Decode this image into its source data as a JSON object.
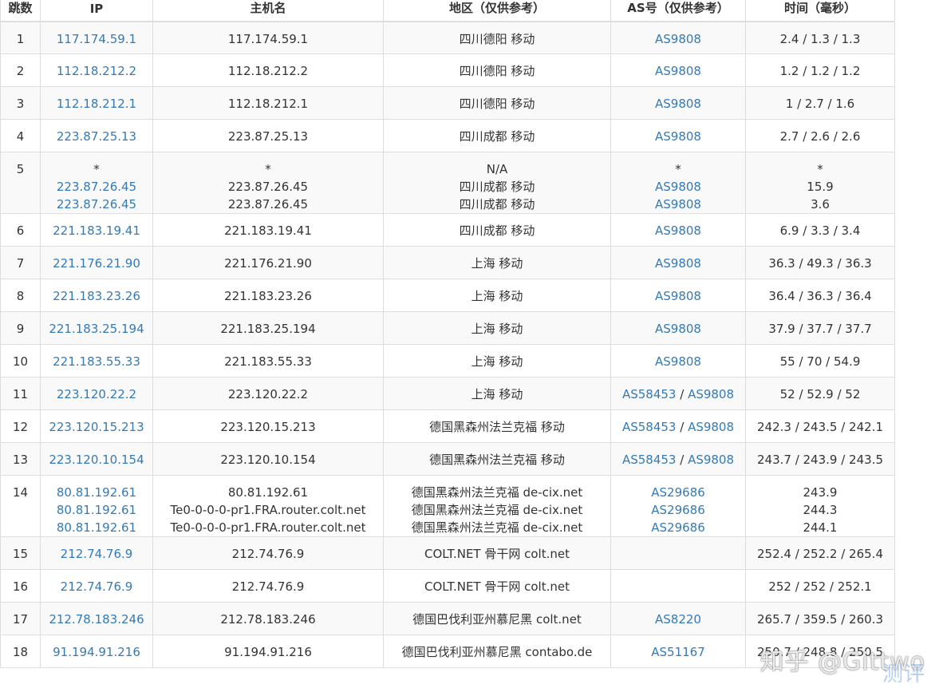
{
  "columns": [
    "跳数",
    "IP",
    "主机名",
    "地区（仅供参考）",
    "AS号（仅供参考）",
    "时间（毫秒）"
  ],
  "rows": [
    {
      "hop": "1",
      "ips": [
        "117.174.59.1"
      ],
      "hosts": [
        "117.174.59.1"
      ],
      "regions": [
        "四川德阳 移动"
      ],
      "as": [
        [
          "AS9808"
        ]
      ],
      "times": [
        "2.4 / 1.3 / 1.3"
      ]
    },
    {
      "hop": "2",
      "ips": [
        "112.18.212.2"
      ],
      "hosts": [
        "112.18.212.2"
      ],
      "regions": [
        "四川德阳 移动"
      ],
      "as": [
        [
          "AS9808"
        ]
      ],
      "times": [
        "1.2 / 1.2 / 1.2"
      ]
    },
    {
      "hop": "3",
      "ips": [
        "112.18.212.1"
      ],
      "hosts": [
        "112.18.212.1"
      ],
      "regions": [
        "四川德阳 移动"
      ],
      "as": [
        [
          "AS9808"
        ]
      ],
      "times": [
        "1 / 2.7 / 1.6"
      ]
    },
    {
      "hop": "4",
      "ips": [
        "223.87.25.13"
      ],
      "hosts": [
        "223.87.25.13"
      ],
      "regions": [
        "四川成都 移动"
      ],
      "as": [
        [
          "AS9808"
        ]
      ],
      "times": [
        "2.7 / 2.6 / 2.6"
      ]
    },
    {
      "hop": "5",
      "ips": [
        "*",
        "223.87.26.45",
        "223.87.26.45"
      ],
      "hosts": [
        "*",
        "223.87.26.45",
        "223.87.26.45"
      ],
      "regions": [
        "N/A",
        "四川成都 移动",
        "四川成都 移动"
      ],
      "as": [
        [
          "*"
        ],
        [
          "AS9808"
        ],
        [
          "AS9808"
        ]
      ],
      "times": [
        "*",
        "15.9",
        "3.6"
      ]
    },
    {
      "hop": "6",
      "ips": [
        "221.183.19.41"
      ],
      "hosts": [
        "221.183.19.41"
      ],
      "regions": [
        "四川成都 移动"
      ],
      "as": [
        [
          "AS9808"
        ]
      ],
      "times": [
        "6.9 / 3.3 / 3.4"
      ]
    },
    {
      "hop": "7",
      "ips": [
        "221.176.21.90"
      ],
      "hosts": [
        "221.176.21.90"
      ],
      "regions": [
        "上海 移动"
      ],
      "as": [
        [
          "AS9808"
        ]
      ],
      "times": [
        "36.3 / 49.3 / 36.3"
      ]
    },
    {
      "hop": "8",
      "ips": [
        "221.183.23.26"
      ],
      "hosts": [
        "221.183.23.26"
      ],
      "regions": [
        "上海 移动"
      ],
      "as": [
        [
          "AS9808"
        ]
      ],
      "times": [
        "36.4 / 36.3 / 36.4"
      ]
    },
    {
      "hop": "9",
      "ips": [
        "221.183.25.194"
      ],
      "hosts": [
        "221.183.25.194"
      ],
      "regions": [
        "上海 移动"
      ],
      "as": [
        [
          "AS9808"
        ]
      ],
      "times": [
        "37.9 / 37.7 / 37.7"
      ]
    },
    {
      "hop": "10",
      "ips": [
        "221.183.55.33"
      ],
      "hosts": [
        "221.183.55.33"
      ],
      "regions": [
        "上海 移动"
      ],
      "as": [
        [
          "AS9808"
        ]
      ],
      "times": [
        "55 / 70 / 54.9"
      ]
    },
    {
      "hop": "11",
      "ips": [
        "223.120.22.2"
      ],
      "hosts": [
        "223.120.22.2"
      ],
      "regions": [
        "上海 移动"
      ],
      "as": [
        [
          "AS58453",
          "AS9808"
        ]
      ],
      "times": [
        "52 / 52.9 / 52"
      ]
    },
    {
      "hop": "12",
      "ips": [
        "223.120.15.213"
      ],
      "hosts": [
        "223.120.15.213"
      ],
      "regions": [
        "德国黑森州法兰克福 移动"
      ],
      "as": [
        [
          "AS58453",
          "AS9808"
        ]
      ],
      "times": [
        "242.3 / 243.5 / 242.1"
      ]
    },
    {
      "hop": "13",
      "ips": [
        "223.120.10.154"
      ],
      "hosts": [
        "223.120.10.154"
      ],
      "regions": [
        "德国黑森州法兰克福 移动"
      ],
      "as": [
        [
          "AS58453",
          "AS9808"
        ]
      ],
      "times": [
        "243.7 / 243.9 / 243.5"
      ]
    },
    {
      "hop": "14",
      "ips": [
        "80.81.192.61",
        "80.81.192.61",
        "80.81.192.61"
      ],
      "hosts": [
        "80.81.192.61",
        "Te0-0-0-0-pr1.FRA.router.colt.net",
        "Te0-0-0-0-pr1.FRA.router.colt.net"
      ],
      "regions": [
        "德国黑森州法兰克福 de-cix.net",
        "德国黑森州法兰克福 de-cix.net",
        "德国黑森州法兰克福 de-cix.net"
      ],
      "as": [
        [
          "AS29686"
        ],
        [
          "AS29686"
        ],
        [
          "AS29686"
        ]
      ],
      "times": [
        "243.9",
        "244.3",
        "244.1"
      ]
    },
    {
      "hop": "15",
      "ips": [
        "212.74.76.9"
      ],
      "hosts": [
        "212.74.76.9"
      ],
      "regions": [
        "COLT.NET 骨干网 colt.net"
      ],
      "as": [
        []
      ],
      "times": [
        "252.4 / 252.2 / 265.4"
      ]
    },
    {
      "hop": "16",
      "ips": [
        "212.74.76.9"
      ],
      "hosts": [
        "212.74.76.9"
      ],
      "regions": [
        "COLT.NET 骨干网 colt.net"
      ],
      "as": [
        []
      ],
      "times": [
        "252 / 252 / 252.1"
      ]
    },
    {
      "hop": "17",
      "ips": [
        "212.78.183.246"
      ],
      "hosts": [
        "212.78.183.246"
      ],
      "regions": [
        "德国巴伐利亚州慕尼黑 colt.net"
      ],
      "as": [
        [
          "AS8220"
        ]
      ],
      "times": [
        "265.7 / 359.5 / 260.3"
      ]
    },
    {
      "hop": "18",
      "ips": [
        "91.194.91.216"
      ],
      "hosts": [
        "91.194.91.216"
      ],
      "regions": [
        "德国巴伐利亚州慕尼黑 contabo.de"
      ],
      "as": [
        [
          "AS51167"
        ]
      ],
      "times": [
        "250.7 / 248.8 / 250.5"
      ]
    }
  ],
  "as_separator": "/",
  "watermark": {
    "main": "知乎 @Gittwo",
    "sub": "测评"
  },
  "colors": {
    "link": "#337ab7",
    "text": "#333333",
    "border": "#dddddd",
    "stripe": "#f9f9f9"
  }
}
